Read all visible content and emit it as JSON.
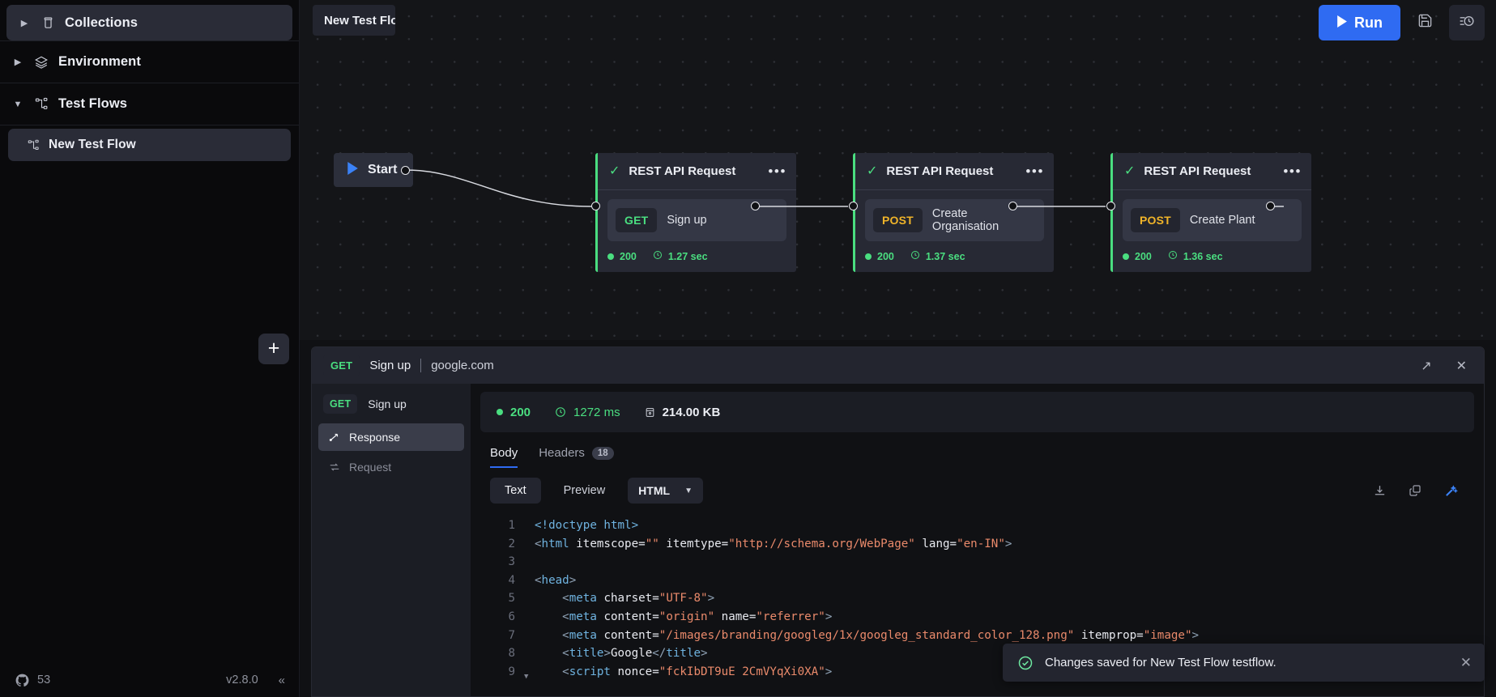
{
  "sidebar": {
    "sections": [
      {
        "label": "Collections",
        "icon": "collection-icon",
        "caret": "▶",
        "expanded": false,
        "highlight": true,
        "has_add": true,
        "add_label": "+"
      },
      {
        "label": "Environment",
        "icon": "layers-icon",
        "caret": "▶",
        "expanded": false,
        "highlight": false,
        "has_add": false
      },
      {
        "label": "Test Flows",
        "icon": "flow-icon",
        "caret": "▼",
        "expanded": true,
        "highlight": false,
        "has_add": false
      }
    ],
    "tree_items": [
      {
        "label": "New Test Flow",
        "icon": "flow-icon",
        "selected": true
      }
    ],
    "status": {
      "github_icon": "github-icon",
      "stars": "53",
      "version": "v2.8.0",
      "collapse_icon": "«"
    }
  },
  "canvas": {
    "flow_tab_label": "New Test Flow",
    "run_button": {
      "label": "Run",
      "icon": "play-icon"
    },
    "top_icons": [
      {
        "name": "save-icon",
        "selected": false
      },
      {
        "name": "history-icon",
        "selected": true
      }
    ],
    "start_node": {
      "label": "Start",
      "icon": "play-icon"
    },
    "nodes": [
      {
        "title": "REST API Request",
        "status_icon": "check-icon",
        "menu_icon": "ellipsis-icon",
        "method": "GET",
        "request_name": "Sign up",
        "status_code": "200",
        "duration": "1.27 sec"
      },
      {
        "title": "REST API Request",
        "status_icon": "check-icon",
        "menu_icon": "ellipsis-icon",
        "method": "POST",
        "request_name": "Create Organisation",
        "status_code": "200",
        "duration": "1.37 sec"
      },
      {
        "title": "REST API Request",
        "status_icon": "check-icon",
        "menu_icon": "ellipsis-icon",
        "method": "POST",
        "request_name": "Create Plant",
        "status_code": "200",
        "duration": "1.36 sec"
      }
    ]
  },
  "response_panel": {
    "header": {
      "method": "GET",
      "name": "Sign up",
      "host": "google.com",
      "expand_icon": "↗",
      "close_icon": "✕"
    },
    "side": {
      "request_method": "GET",
      "request_name": "Sign up",
      "tabs": [
        {
          "label": "Response",
          "icon": "response-icon",
          "active": true
        },
        {
          "label": "Request",
          "icon": "request-icon",
          "active": false
        }
      ]
    },
    "stats": {
      "status_code": "200",
      "time": "1272 ms",
      "size": "214.00 KB",
      "time_icon": "clock-icon",
      "size_icon": "database-icon"
    },
    "tabs": [
      {
        "label": "Body",
        "active": true,
        "badge": ""
      },
      {
        "label": "Headers",
        "active": false,
        "badge": "18"
      }
    ],
    "view_controls": {
      "modes": [
        {
          "label": "Text",
          "active": true
        },
        {
          "label": "Preview",
          "active": false
        }
      ],
      "format_selected": "HTML",
      "chevron": "▼",
      "actions": [
        {
          "name": "download-icon",
          "accent": false
        },
        {
          "name": "copy-icon",
          "accent": false
        },
        {
          "name": "magic-wand-icon",
          "accent": true
        }
      ]
    },
    "code_lines": [
      {
        "num": "1",
        "fold": false,
        "tokens": [
          {
            "t": "tag",
            "v": "<!doctype html>"
          }
        ]
      },
      {
        "num": "2",
        "fold": false,
        "tokens": [
          {
            "t": "punc",
            "v": "<"
          },
          {
            "t": "tag",
            "v": "html"
          },
          {
            "t": "txt",
            "v": " "
          },
          {
            "t": "attr",
            "v": "itemscope="
          },
          {
            "t": "str",
            "v": "\"\""
          },
          {
            "t": "txt",
            "v": " "
          },
          {
            "t": "attr",
            "v": "itemtype="
          },
          {
            "t": "str",
            "v": "\"http://schema.org/WebPage\""
          },
          {
            "t": "txt",
            "v": " "
          },
          {
            "t": "attr",
            "v": "lang="
          },
          {
            "t": "str",
            "v": "\"en-IN\""
          },
          {
            "t": "punc",
            "v": ">"
          }
        ]
      },
      {
        "num": "3",
        "fold": false,
        "tokens": []
      },
      {
        "num": "4",
        "fold": false,
        "tokens": [
          {
            "t": "punc",
            "v": "<"
          },
          {
            "t": "tag",
            "v": "head"
          },
          {
            "t": "punc",
            "v": ">"
          }
        ]
      },
      {
        "num": "5",
        "fold": false,
        "tokens": [
          {
            "t": "txt",
            "v": "    "
          },
          {
            "t": "punc",
            "v": "<"
          },
          {
            "t": "tag",
            "v": "meta"
          },
          {
            "t": "txt",
            "v": " "
          },
          {
            "t": "attr",
            "v": "charset="
          },
          {
            "t": "str",
            "v": "\"UTF-8\""
          },
          {
            "t": "punc",
            "v": ">"
          }
        ]
      },
      {
        "num": "6",
        "fold": false,
        "tokens": [
          {
            "t": "txt",
            "v": "    "
          },
          {
            "t": "punc",
            "v": "<"
          },
          {
            "t": "tag",
            "v": "meta"
          },
          {
            "t": "txt",
            "v": " "
          },
          {
            "t": "attr",
            "v": "content="
          },
          {
            "t": "str",
            "v": "\"origin\""
          },
          {
            "t": "txt",
            "v": " "
          },
          {
            "t": "attr",
            "v": "name="
          },
          {
            "t": "str",
            "v": "\"referrer\""
          },
          {
            "t": "punc",
            "v": ">"
          }
        ]
      },
      {
        "num": "7",
        "fold": false,
        "tokens": [
          {
            "t": "txt",
            "v": "    "
          },
          {
            "t": "punc",
            "v": "<"
          },
          {
            "t": "tag",
            "v": "meta"
          },
          {
            "t": "txt",
            "v": " "
          },
          {
            "t": "attr",
            "v": "content="
          },
          {
            "t": "str",
            "v": "\"/images/branding/googleg/1x/googleg_standard_color_128.png\""
          },
          {
            "t": "txt",
            "v": " "
          },
          {
            "t": "attr",
            "v": "itemprop="
          },
          {
            "t": "str",
            "v": "\"image\""
          },
          {
            "t": "punc",
            "v": ">"
          }
        ]
      },
      {
        "num": "8",
        "fold": false,
        "tokens": [
          {
            "t": "txt",
            "v": "    "
          },
          {
            "t": "punc",
            "v": "<"
          },
          {
            "t": "tag",
            "v": "title"
          },
          {
            "t": "punc",
            "v": ">"
          },
          {
            "t": "txt",
            "v": "Google"
          },
          {
            "t": "punc",
            "v": "</"
          },
          {
            "t": "tag",
            "v": "title"
          },
          {
            "t": "punc",
            "v": ">"
          }
        ]
      },
      {
        "num": "9",
        "fold": true,
        "tokens": [
          {
            "t": "txt",
            "v": "    "
          },
          {
            "t": "punc",
            "v": "<"
          },
          {
            "t": "tag",
            "v": "script"
          },
          {
            "t": "txt",
            "v": " "
          },
          {
            "t": "attr",
            "v": "nonce="
          },
          {
            "t": "str",
            "v": "\"fckIbDT9uE 2CmVYqXi0XA\""
          },
          {
            "t": "punc",
            "v": ">"
          }
        ]
      }
    ]
  },
  "toast": {
    "icon": "check-circle-icon",
    "message": "Changes saved for New Test Flow testflow.",
    "close_icon": "✕"
  }
}
